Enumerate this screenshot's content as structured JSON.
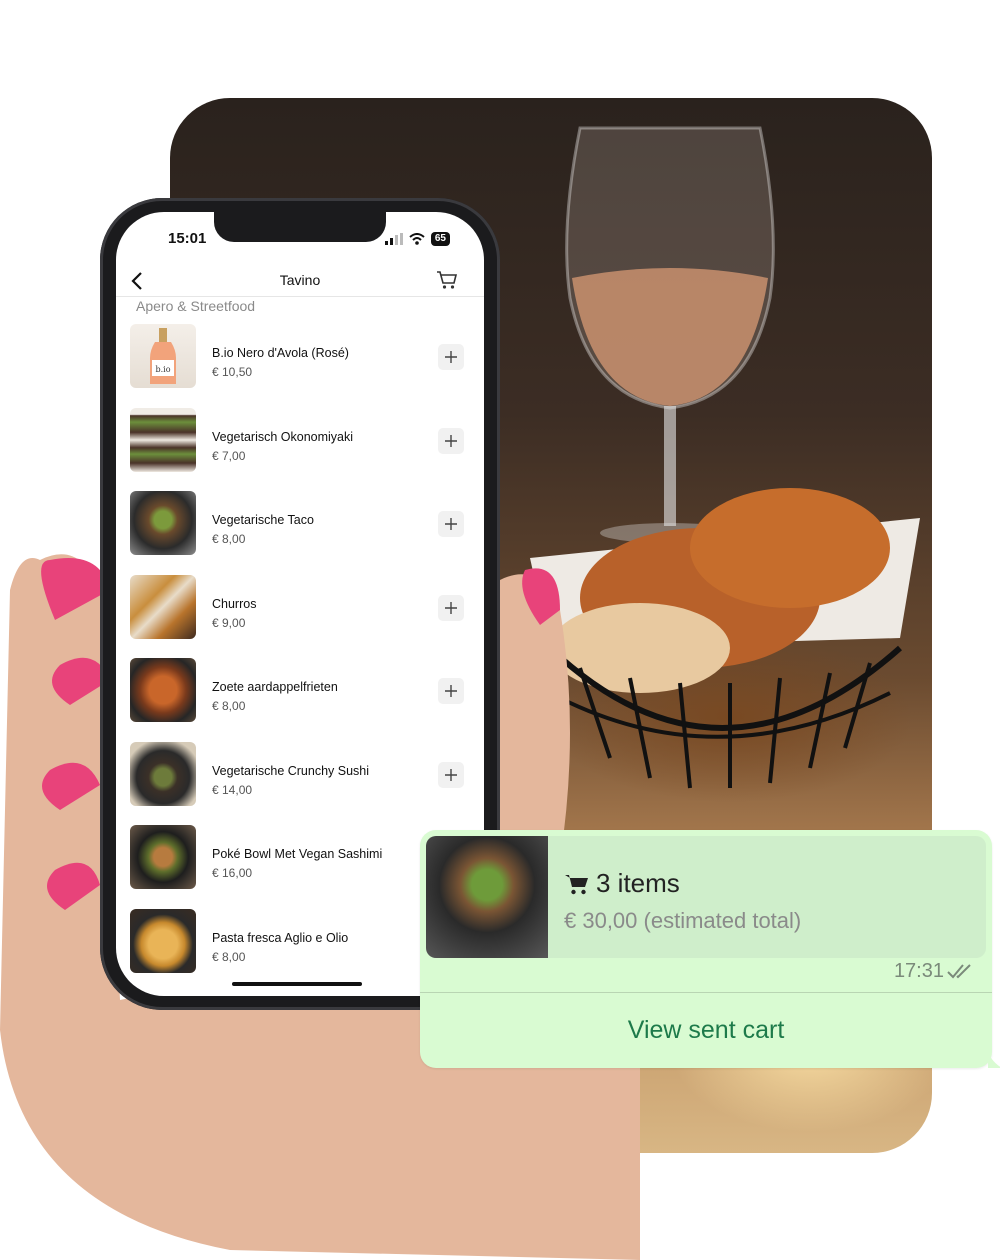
{
  "status_bar": {
    "time": "15:01",
    "battery": "65"
  },
  "nav": {
    "title": "Tavino"
  },
  "section": {
    "title": "Apero & Streetfood"
  },
  "menu_items": [
    {
      "name": "B.io Nero d'Avola (Rosé)",
      "price": "€ 10,50"
    },
    {
      "name": "Vegetarisch Okonomiyaki",
      "price": "€ 7,00"
    },
    {
      "name": "Vegetarische Taco",
      "price": "€ 8,00"
    },
    {
      "name": "Churros",
      "price": "€ 9,00"
    },
    {
      "name": "Zoete aardappelfrieten",
      "price": "€ 8,00"
    },
    {
      "name": "Vegetarische Crunchy Sushi",
      "price": "€ 14,00"
    },
    {
      "name": "Poké Bowl Met Vegan Sashimi",
      "price": "€ 16,00"
    },
    {
      "name": "Pasta fresca Aglio e Olio",
      "price": "€ 8,00"
    }
  ],
  "chat": {
    "items_count": "3 items",
    "estimated_total": "€ 30,00 (estimated total)",
    "time": "17:31",
    "view_cart_label": "View sent cart",
    "bottle_label": "b.io"
  },
  "colors": {
    "bubble_bg": "#d9fbd2",
    "link_green": "#1d7a4a",
    "nail_pink": "#e8437a"
  }
}
